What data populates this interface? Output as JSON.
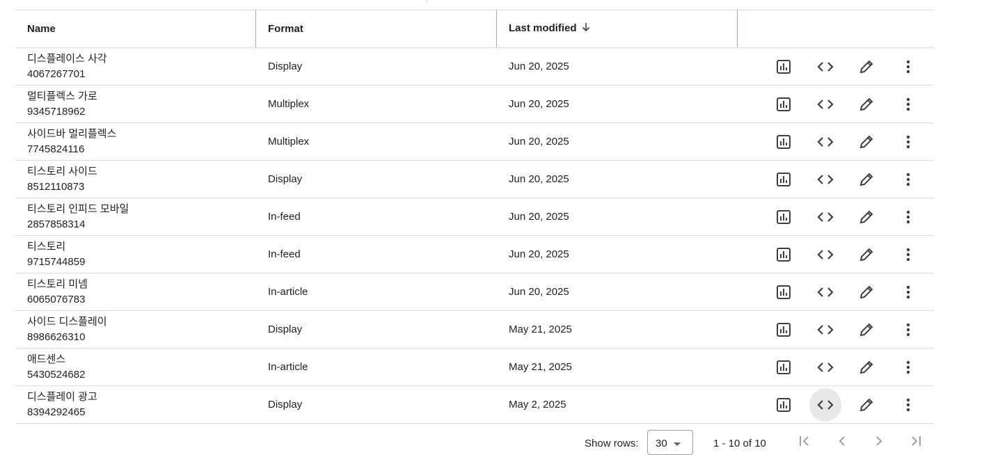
{
  "table": {
    "headers": {
      "name": "Name",
      "format": "Format",
      "last_modified": "Last modified"
    },
    "rows": [
      {
        "name": "디스플레이스 사각",
        "id": "4067267701",
        "format": "Display",
        "last_modified": "Jun 20, 2025"
      },
      {
        "name": "멀티플렉스 가로",
        "id": "9345718962",
        "format": "Multiplex",
        "last_modified": "Jun 20, 2025"
      },
      {
        "name": "사이드바 멀리플렉스",
        "id": "7745824116",
        "format": "Multiplex",
        "last_modified": "Jun 20, 2025"
      },
      {
        "name": "티스토리 사이드",
        "id": "8512110873",
        "format": "Display",
        "last_modified": "Jun 20, 2025"
      },
      {
        "name": "티스토리 인피드 모바일",
        "id": "2857858314",
        "format": "In-feed",
        "last_modified": "Jun 20, 2025"
      },
      {
        "name": "티스토리",
        "id": "9715744859",
        "format": "In-feed",
        "last_modified": "Jun 20, 2025"
      },
      {
        "name": "티스토리 미넴",
        "id": "6065076783",
        "format": "In-article",
        "last_modified": "Jun 20, 2025"
      },
      {
        "name": "사이드 디스플레이",
        "id": "8986626310",
        "format": "Display",
        "last_modified": "May 21, 2025"
      },
      {
        "name": "애드센스",
        "id": "5430524682",
        "format": "In-article",
        "last_modified": "May 21, 2025"
      },
      {
        "name": "디스플레이 광고",
        "id": "8394292465",
        "format": "Display",
        "last_modified": "May 2, 2025"
      }
    ],
    "row_actions": [
      "report-icon",
      "code-icon",
      "edit-pencil-icon",
      "more-vert-icon"
    ]
  },
  "footer": {
    "show_rows_label": "Show rows:",
    "rows_per_page": "30",
    "range_text": "1 - 10 of 10"
  },
  "colors": {
    "divider": "#dadce0",
    "column_resize": "#7fb4e6",
    "icon": "#3c4043"
  }
}
